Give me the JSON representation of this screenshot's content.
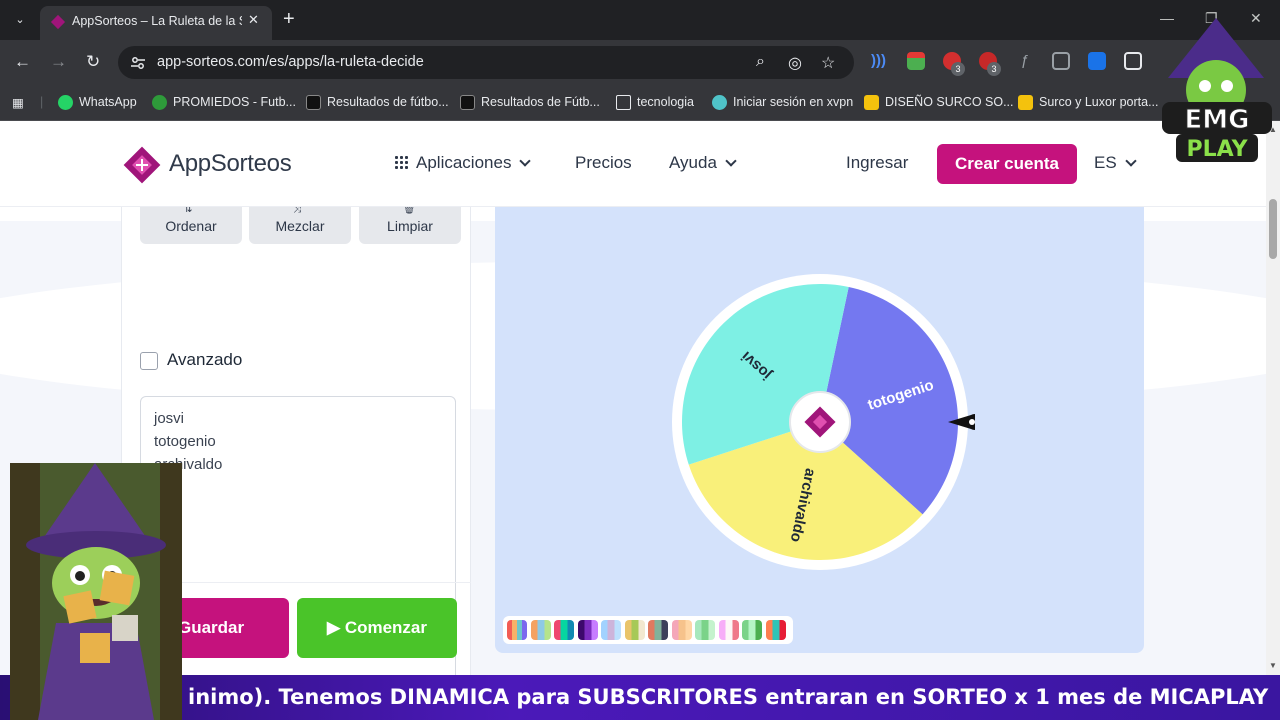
{
  "browser": {
    "tab_title": "AppSorteos – La Ruleta de la Suerte",
    "url": "app-sorteos.com/es/apps/la-ruleta-decide",
    "ext_badge_1": "3",
    "ext_badge_2": "3",
    "bookmarks": [
      {
        "label": "WhatsApp",
        "color": "#25d366"
      },
      {
        "label": "PROMIEDOS - Futb...",
        "color": "#2e9b3a"
      },
      {
        "label": "Resultados de fútbo...",
        "color": "#111111"
      },
      {
        "label": "Resultados de Fútb...",
        "color": "#111111"
      },
      {
        "label": "tecnologia",
        "color": "#e8eaed"
      },
      {
        "label": "Iniciar sesión en xvpn",
        "color": "#4fc3c8"
      },
      {
        "label": "DISEÑO SURCO SO...",
        "color": "#f4c20d"
      },
      {
        "label": "Surco y Luxor porta...",
        "color": "#f4c20d"
      }
    ]
  },
  "site": {
    "brand": "AppSorteos",
    "nav": {
      "apps": "Aplicaciones",
      "pricing": "Precios",
      "help": "Ayuda",
      "login": "Ingresar",
      "signup": "Crear cuenta",
      "lang": "ES"
    },
    "tools": {
      "sort": "Ordenar",
      "shuffle": "Mezclar",
      "clear": "Limpiar"
    },
    "advanced_label": "Avanzado",
    "names": [
      "josvi",
      "totogenio",
      "archivaldo"
    ],
    "save_label": "Guardar",
    "start_label": "Comenzar"
  },
  "wheel": {
    "segments": [
      {
        "label": "totogenio",
        "color": "#7478f0"
      },
      {
        "label": "archivaldo",
        "color": "#f9f07a"
      },
      {
        "label": "josvi",
        "color": "#7ef0e4"
      }
    ],
    "palette": [
      [
        "#f25c54",
        "#f7b267",
        "#6ec6ca",
        "#7b68ee"
      ],
      [
        "#f4a261",
        "#8ecae6",
        "#b5e48c"
      ],
      [
        "#ef476f",
        "#06d6a0",
        "#118ab2"
      ],
      [
        "#3c096c",
        "#7b2cbf",
        "#c77dff"
      ],
      [
        "#a2d2ff",
        "#cdb4db",
        "#bde0fe"
      ],
      [
        "#e9c46a",
        "#a7c957",
        "#f2e8cf"
      ],
      [
        "#e07a5f",
        "#81b29a",
        "#3d405b"
      ],
      [
        "#f4a7b9",
        "#f6c28b",
        "#ffd6a5"
      ],
      [
        "#a7e8bd",
        "#7bd389",
        "#c5f3cd"
      ],
      [
        "#f7aef8",
        "#fdf7f7",
        "#ef798a"
      ],
      [
        "#7bd389",
        "#b5f5c5",
        "#4caf50"
      ],
      [
        "#ff7f50",
        "#2ec4b6",
        "#e71d36"
      ]
    ]
  },
  "overlay": {
    "banner": "inimo).          Tenemos DINAMICA para SUBSCRITORES entraran en SORTEO x 1 mes de MICAPLAY",
    "logo_line1": "EMG",
    "logo_line2": "PLAY"
  }
}
